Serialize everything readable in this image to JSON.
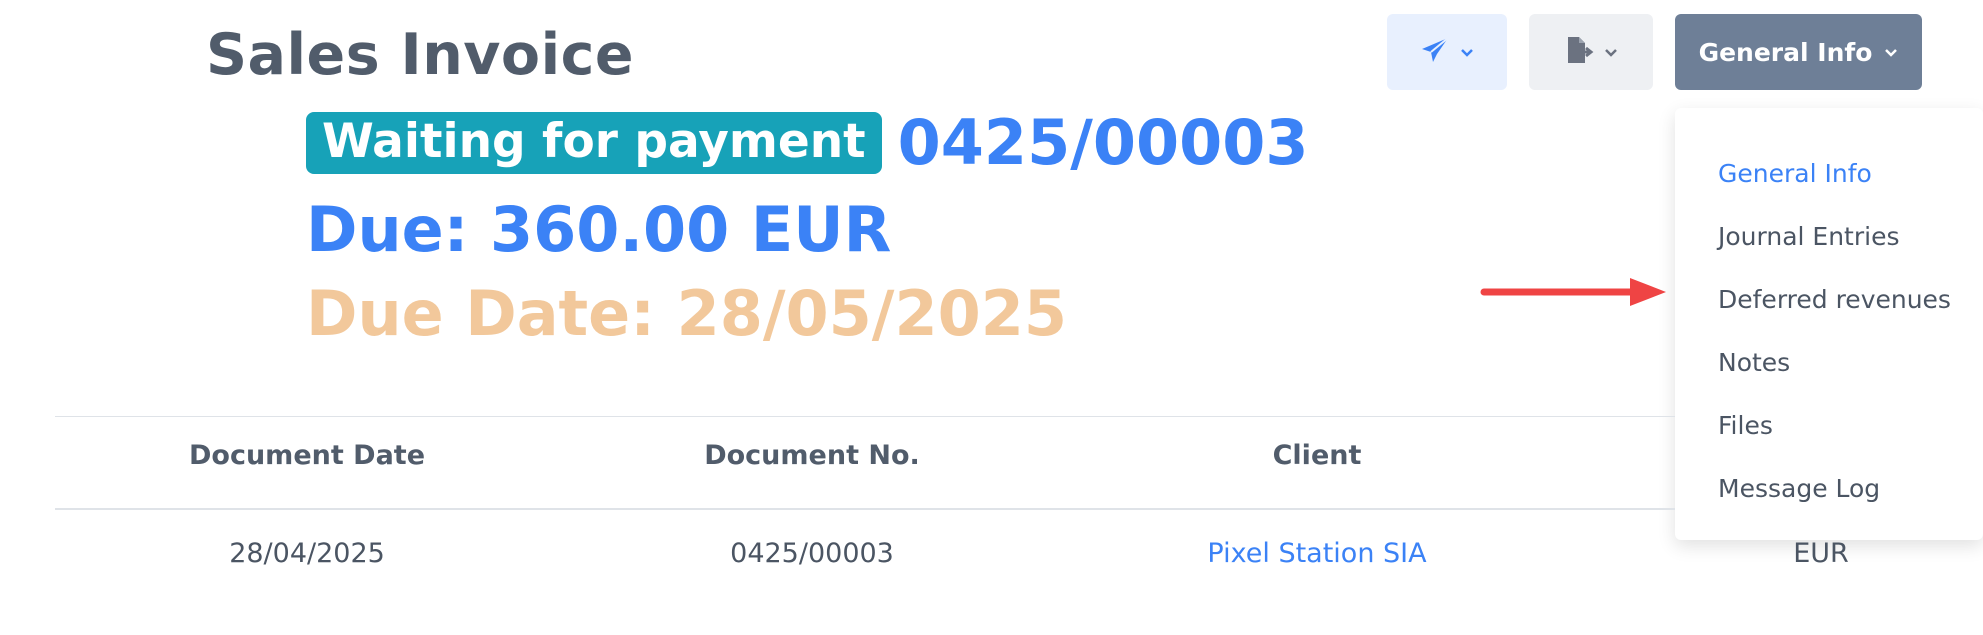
{
  "page": {
    "title": "Sales Invoice"
  },
  "status": {
    "badge": "Waiting for payment",
    "document_number": "0425/00003",
    "due": "Due: 360.00 EUR",
    "due_date": "Due Date: 28/05/2025"
  },
  "toolbar": {
    "send_icon": "paper-plane-icon",
    "export_icon": "file-export-icon",
    "general_info_label": "General Info"
  },
  "dropdown": {
    "items": [
      {
        "label": "General Info",
        "active": true
      },
      {
        "label": "Journal Entries",
        "active": false
      },
      {
        "label": "Deferred revenues",
        "active": false
      },
      {
        "label": "Notes",
        "active": false
      },
      {
        "label": "Files",
        "active": false
      },
      {
        "label": "Message Log",
        "active": false
      }
    ]
  },
  "table": {
    "headers": [
      "Document Date",
      "Document No.",
      "Client"
    ],
    "row": {
      "document_date": "28/04/2025",
      "document_no": "0425/00003",
      "client": "Pixel Station SIA",
      "currency": "EUR"
    }
  },
  "colors": {
    "accent": "#3b82f6",
    "badge": "#17a2b8",
    "due_date": "#f2c89b",
    "general_button": "#6e7f97",
    "arrow": "#ef4444"
  }
}
